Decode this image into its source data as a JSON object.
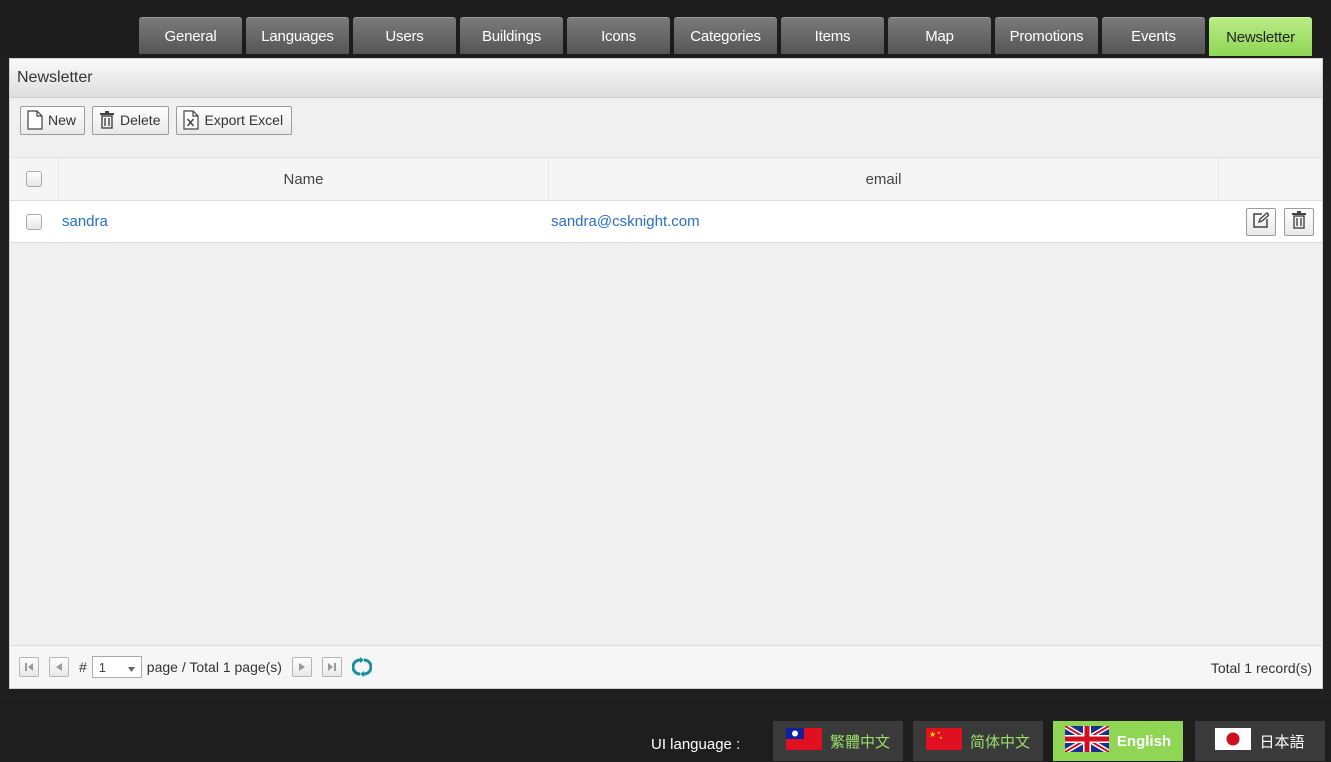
{
  "nav": {
    "tabs": [
      {
        "label": "General",
        "active": false
      },
      {
        "label": "Languages",
        "active": false
      },
      {
        "label": "Users",
        "active": false
      },
      {
        "label": "Buildings",
        "active": false
      },
      {
        "label": "Icons",
        "active": false
      },
      {
        "label": "Categories",
        "active": false
      },
      {
        "label": "Items",
        "active": false
      },
      {
        "label": "Map",
        "active": false
      },
      {
        "label": "Promotions",
        "active": false
      },
      {
        "label": "Events",
        "active": false
      },
      {
        "label": "Newsletter",
        "active": true
      }
    ]
  },
  "panel": {
    "title": "Newsletter"
  },
  "toolbar": {
    "new_label": "New",
    "delete_label": "Delete",
    "export_label": "Export Excel"
  },
  "grid": {
    "columns": [
      "Name",
      "email"
    ],
    "rows": [
      {
        "name": "sandra",
        "email": "sandra@csknight.com"
      }
    ]
  },
  "pager": {
    "hash": "#",
    "current_page": "1",
    "page_text": "page /  Total 1 page(s)",
    "total_records": "Total 1 record(s)"
  },
  "footer": {
    "ui_language_label": "UI language :",
    "languages": [
      {
        "label": "繁體中文",
        "flag": "taiwan-flag-icon",
        "active": false
      },
      {
        "label": "简体中文",
        "flag": "china-flag-icon",
        "active": false
      },
      {
        "label": "English",
        "flag": "uk-flag-icon",
        "active": true
      },
      {
        "label": "日本語",
        "flag": "japan-flag-icon",
        "active": false
      }
    ]
  },
  "colors": {
    "active_tab": "#8fd655",
    "link": "#2a6ec8",
    "refresh_icon": "#1a8fa0"
  }
}
